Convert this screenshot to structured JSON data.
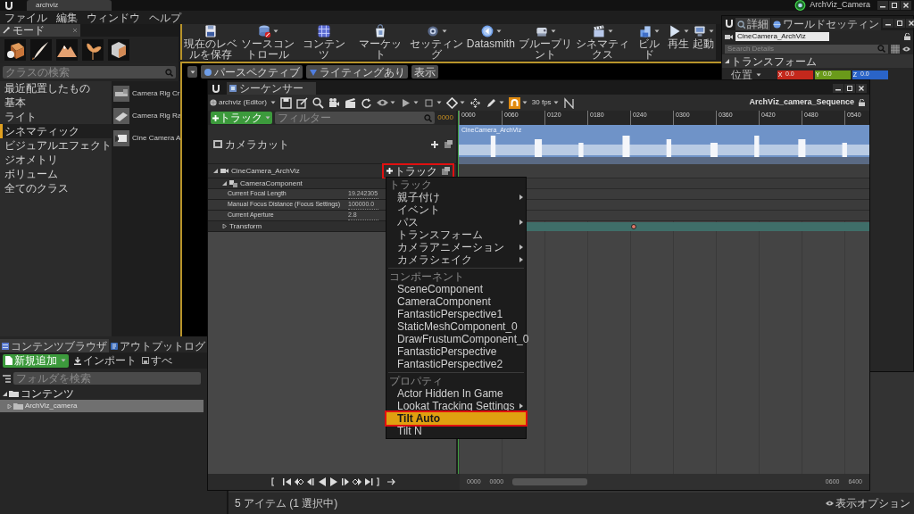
{
  "title_bar": {
    "tab": "archviz",
    "project": "ArchViz_Camera"
  },
  "menu": [
    "ファイル",
    "編集",
    "ウィンドウ",
    "ヘルプ"
  ],
  "modes": {
    "tab": "モード",
    "search": {
      "placeholder": "クラスの検索"
    },
    "categories": [
      {
        "label": "最近配置したもの",
        "selected": false
      },
      {
        "label": "基本",
        "selected": false
      },
      {
        "label": "ライト",
        "selected": false
      },
      {
        "label": "シネマティック",
        "selected": true
      },
      {
        "label": "ビジュアルエフェクト",
        "selected": false
      },
      {
        "label": "ジオメトリ",
        "selected": false
      },
      {
        "label": "ボリューム",
        "selected": false
      },
      {
        "label": "全てのクラス",
        "selected": false
      }
    ],
    "items": [
      "Camera Rig Cr",
      "Camera Rig Ra",
      "Cine Camera A"
    ]
  },
  "toolbar": [
    {
      "label": "現在のレベルを保存",
      "dropdown": false
    },
    {
      "label": "ソースコントロール",
      "dropdown": true
    },
    {
      "label": "コンテンツ",
      "dropdown": false
    },
    {
      "label": "マーケット",
      "dropdown": false
    },
    {
      "label": "セッティング",
      "dropdown": true
    },
    {
      "label": "Datasmith",
      "dropdown": true
    },
    {
      "label": "ブループリント",
      "dropdown": true
    },
    {
      "label": "シネマティクス",
      "dropdown": true
    },
    {
      "label": "ビルド",
      "dropdown": true
    },
    {
      "label": "再生",
      "dropdown": true
    },
    {
      "label": "起動",
      "dropdown": true
    }
  ],
  "viewport": {
    "buttons": [
      "パースペクティブ",
      "ライティングあり",
      "表示"
    ]
  },
  "details": {
    "tabs": [
      {
        "label": "詳細",
        "selected": true
      },
      {
        "label": "ワールドセッティン",
        "selected": false
      }
    ],
    "name": "CineCamera_ArchViz",
    "search": {
      "placeholder": "Search Details"
    },
    "section": "トランスフォーム",
    "location": {
      "label": "位置",
      "axes": [
        {
          "axis": "X",
          "value": "0.0",
          "color": "#c4281c"
        },
        {
          "axis": "Y",
          "value": "0.0",
          "color": "#6a9a1a"
        },
        {
          "axis": "Z",
          "value": "0.0",
          "color": "#2a64c8"
        }
      ]
    }
  },
  "sequencer": {
    "tab": "シーケンサー",
    "world": "archviz (Editor)",
    "fps": "30 fps",
    "title": "ArchViz_camera_Sequence",
    "add_track": "トラック",
    "filter": {
      "placeholder": "フィルター"
    },
    "time": "0000",
    "tracks": [
      {
        "label": "カメラカット",
        "kind": "cut"
      },
      {
        "label": "CineCamera_ArchViz",
        "kind": "actor",
        "expanded": true,
        "track_button": {
          "label": "トラック",
          "callout": true
        },
        "children": [
          {
            "label": "CameraComponent",
            "kind": "component",
            "expanded": true,
            "children": [
              {
                "label": "Current Focal Length",
                "kind": "property",
                "value": "19.242305"
              },
              {
                "label": "Manual Focus Distance (Focus Settings)",
                "kind": "property",
                "value": "100000.0"
              },
              {
                "label": "Current Aperture",
                "kind": "property",
                "value": "2.8"
              }
            ]
          },
          {
            "label": "Transform",
            "kind": "group",
            "expanded": false
          }
        ]
      }
    ],
    "ruler": [
      "0000",
      "0060",
      "0120",
      "0180",
      "0240",
      "0300",
      "0360",
      "0420",
      "0480",
      "0540"
    ],
    "shot_label": "CineCamera_ArchViz",
    "range": [
      "0000",
      "0000",
      "0600",
      "6400"
    ]
  },
  "context_menu": [
    {
      "title": "トラック",
      "items": [
        {
          "label": "親子付け",
          "submenu": true,
          "selected": false
        },
        {
          "label": "イベント",
          "submenu": false,
          "selected": false
        },
        {
          "label": "パス",
          "submenu": true,
          "selected": false
        },
        {
          "label": "トランスフォーム",
          "submenu": false,
          "selected": false
        },
        {
          "label": "カメラアニメーション",
          "submenu": true,
          "selected": false
        },
        {
          "label": "カメラシェイク",
          "submenu": true,
          "selected": false
        }
      ]
    },
    {
      "title": "コンポーネント",
      "items": [
        {
          "label": "SceneComponent",
          "submenu": false,
          "selected": false
        },
        {
          "label": "CameraComponent",
          "submenu": false,
          "selected": false
        },
        {
          "label": "FantasticPerspective1",
          "submenu": false,
          "selected": false
        },
        {
          "label": "StaticMeshComponent_0",
          "submenu": false,
          "selected": false
        },
        {
          "label": "DrawFrustumComponent_0",
          "submenu": false,
          "selected": false
        },
        {
          "label": "FantasticPerspective",
          "submenu": false,
          "selected": false
        },
        {
          "label": "FantasticPerspective2",
          "submenu": false,
          "selected": false
        }
      ]
    },
    {
      "title": "プロパティ",
      "items": [
        {
          "label": "Actor Hidden In Game",
          "submenu": false,
          "selected": false
        },
        {
          "label": "Lookat Tracking Settings",
          "submenu": true,
          "selected": false
        },
        {
          "label": "Tilt Auto",
          "submenu": false,
          "selected": true,
          "callout": true
        },
        {
          "label": "Tilt N",
          "submenu": false,
          "selected": false
        }
      ]
    }
  ],
  "content_browser": {
    "tabs": [
      {
        "label": "コンテンツブラウザ",
        "selected": true
      },
      {
        "label": "アウトプットログ",
        "selected": false
      }
    ],
    "add_new": "新規追加",
    "import": "インポート",
    "save_all": "すべ",
    "search": {
      "placeholder": "フォルダを検索"
    },
    "tree": [
      {
        "label": "コンテンツ",
        "expanded": true,
        "selected": false,
        "children": [
          {
            "label": "ArchViz_camera",
            "expanded": false,
            "selected": true
          }
        ]
      }
    ],
    "status": "5 アイテム (1 選択中)",
    "view_options": "表示オプション"
  }
}
